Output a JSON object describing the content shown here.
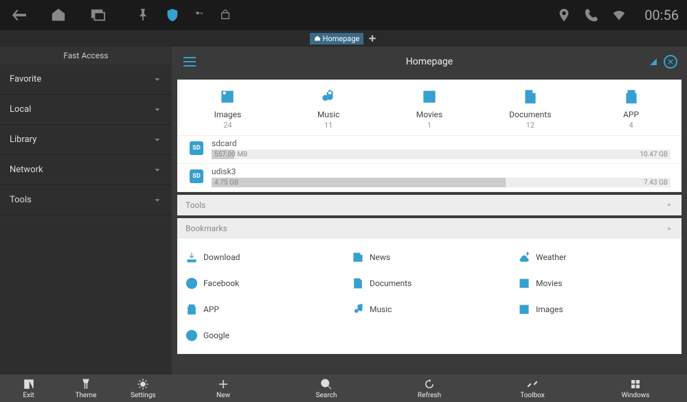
{
  "statusbar": {
    "time": "00:56"
  },
  "tab": {
    "label": "Homepage"
  },
  "sidebar": {
    "header": "Fast Access",
    "items": [
      {
        "label": "Favorite"
      },
      {
        "label": "Local"
      },
      {
        "label": "Library"
      },
      {
        "label": "Network"
      },
      {
        "label": "Tools"
      }
    ]
  },
  "title": "Homepage",
  "categories": [
    {
      "label": "Images",
      "count": "24"
    },
    {
      "label": "Music",
      "count": "11"
    },
    {
      "label": "Movies",
      "count": "1"
    },
    {
      "label": "Documents",
      "count": "12"
    },
    {
      "label": "APP",
      "count": "4"
    }
  ],
  "storage": [
    {
      "name": "sdcard",
      "used": "557.00 MB",
      "total": "10.47 GB",
      "pct": 5
    },
    {
      "name": "udisk3",
      "used": "4.75 GB",
      "total": "7.43 GB",
      "pct": 64
    }
  ],
  "sections": {
    "tools": "Tools",
    "bookmarks": "Bookmarks"
  },
  "bookmarks": [
    {
      "label": "Download"
    },
    {
      "label": "News"
    },
    {
      "label": "Weather"
    },
    {
      "label": "Facebook"
    },
    {
      "label": "Documents"
    },
    {
      "label": "Movies"
    },
    {
      "label": "APP"
    },
    {
      "label": "Music"
    },
    {
      "label": "Images"
    },
    {
      "label": "Google"
    }
  ],
  "bottom_left": [
    {
      "label": "Exit"
    },
    {
      "label": "Theme"
    },
    {
      "label": "Settings"
    }
  ],
  "bottom_right": [
    {
      "label": "New"
    },
    {
      "label": "Search"
    },
    {
      "label": "Refresh"
    },
    {
      "label": "Toolbox"
    },
    {
      "label": "Windows"
    }
  ]
}
